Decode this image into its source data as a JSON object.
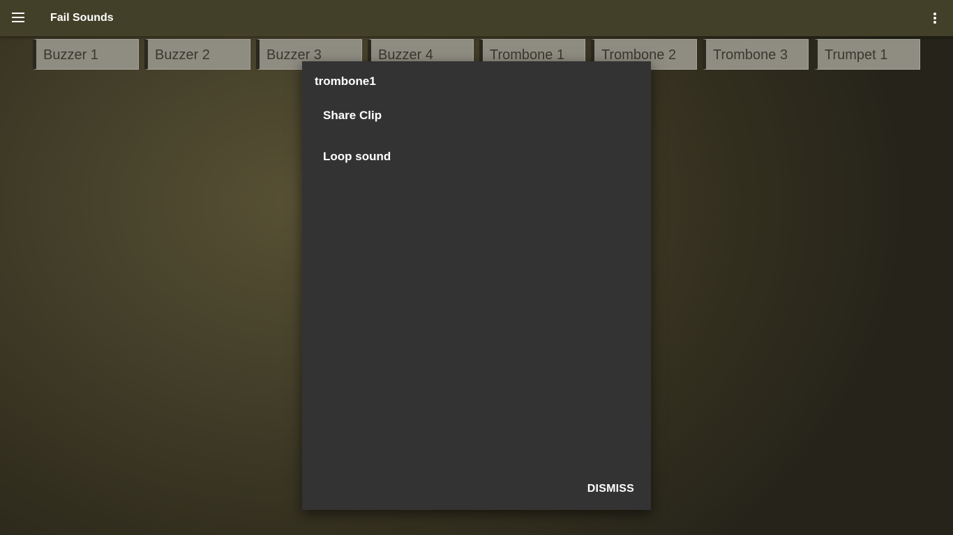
{
  "appbar": {
    "title": "Fail Sounds",
    "menu_icon": "hamburger-menu-icon",
    "more_icon": "more-vertical-icon"
  },
  "sounds": [
    {
      "label": "Buzzer 1"
    },
    {
      "label": "Buzzer 2"
    },
    {
      "label": "Buzzer 3"
    },
    {
      "label": "Buzzer 4"
    },
    {
      "label": "Trombone 1"
    },
    {
      "label": "Trombone 2"
    },
    {
      "label": "Trombone 3"
    },
    {
      "label": "Trumpet 1"
    }
  ],
  "dialog": {
    "title": "trombone1",
    "options": [
      {
        "label": "Share Clip"
      },
      {
        "label": "Loop sound"
      }
    ],
    "dismiss_label": "DISMISS"
  },
  "colors": {
    "appbar": "#434029",
    "dialog": "#333333",
    "sound_button": "#8f8c82",
    "background_center": "#575034",
    "background_edge": "#25231a"
  }
}
